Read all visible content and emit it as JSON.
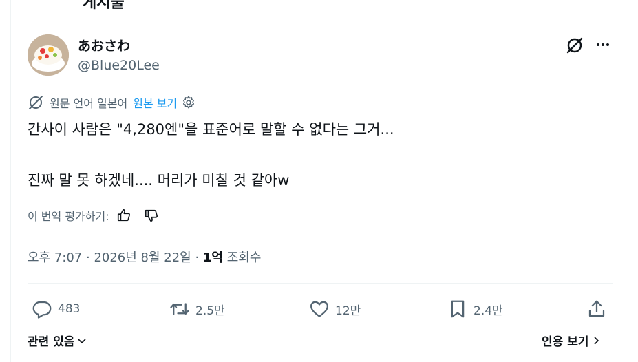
{
  "header": {
    "title": "게시물"
  },
  "author": {
    "display_name": "あおさわ",
    "handle": "@Blue20Lee"
  },
  "translation": {
    "note": "원문 언어 일본어",
    "link": "원본 보기"
  },
  "post": {
    "line1": "간사이 사람은 \"4,280엔\"을 표준어로 말할 수 없다는 그거...",
    "line2": "진짜 말 못 하겠네.... 머리가 미칠 것 같아w"
  },
  "rate": {
    "label": "이 번역 평가하기:"
  },
  "meta": {
    "time": "오후 7:07",
    "sep1": " · ",
    "date": "2026년 8월 22일",
    "sep2": " · ",
    "views_count": "1억",
    "views_label": " 조회수"
  },
  "actions": {
    "replies": "483",
    "reposts": "2.5만",
    "likes": "12만",
    "bookmarks": "2.4만"
  },
  "footer": {
    "related": "관련 있음",
    "quotes": "인용 보기"
  }
}
